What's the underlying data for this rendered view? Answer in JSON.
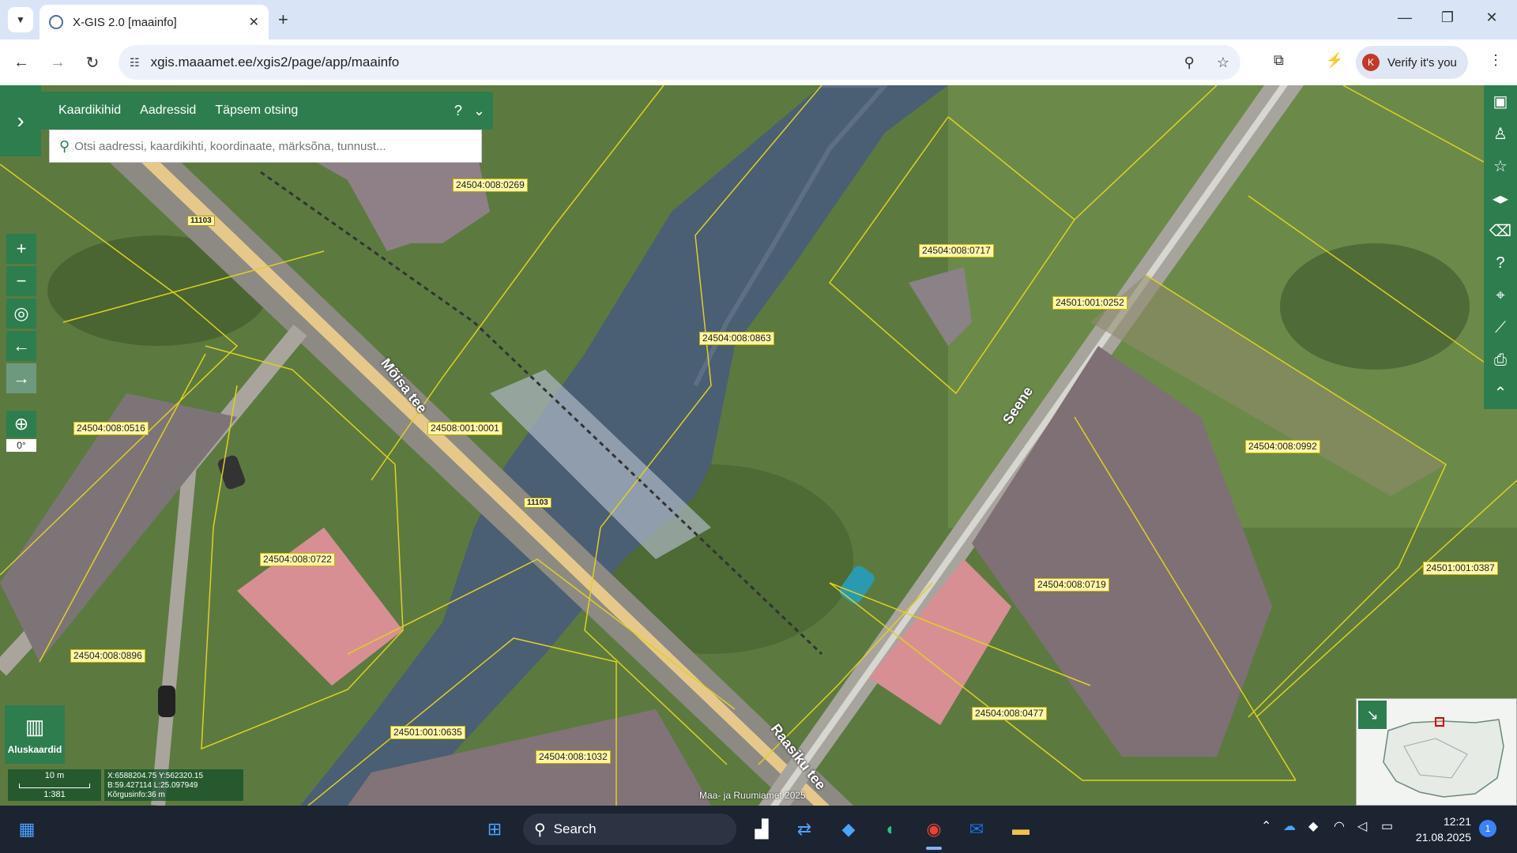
{
  "browser": {
    "tab_title": "X-GIS 2.0 [maainfo]",
    "url": "xgis.maaamet.ee/xgis2/page/app/maainfo",
    "profile_initial": "K",
    "verify_label": "Verify it's you"
  },
  "search_panel": {
    "tabs": [
      "Kaardikihid",
      "Aadressid",
      "Täpsem otsing"
    ],
    "help": "?",
    "placeholder": "Otsi aadressi, kaardikihti, koordinaate, märksõna, tunnust..."
  },
  "map_controls": {
    "angle": "0°",
    "basemaps_label": "Aluskaardid"
  },
  "scale": {
    "distance": "10 m",
    "ratio": "1:381"
  },
  "coords": {
    "line1": "X:6588204.75 Y:562320.15",
    "line2": "B:59.427114 L:25.097949",
    "line3": "Kõrgusinfo:36 m"
  },
  "copyright": "Maa- ja Ruumiamet 2025",
  "parcels": [
    "24504:008:0269",
    "24504:008:0717",
    "24501:001:0252",
    "24504:008:0863",
    "24504:008:0516",
    "24508:001:0001",
    "24504:008:0992",
    "24504:008:0722",
    "24504:008:0719",
    "24501:001:0387",
    "24504:008:0896",
    "24504:008:0477",
    "24501:001:0635",
    "24504:008:1032"
  ],
  "roads": {
    "moisa": "Mõisa tee",
    "seene": "Seene",
    "raasiku": "Raasiku tee",
    "num1": "11103",
    "num2": "11103"
  },
  "taskbar": {
    "search_label": "Search",
    "time": "12:21",
    "date": "21.08.2025",
    "notifications": "1"
  }
}
